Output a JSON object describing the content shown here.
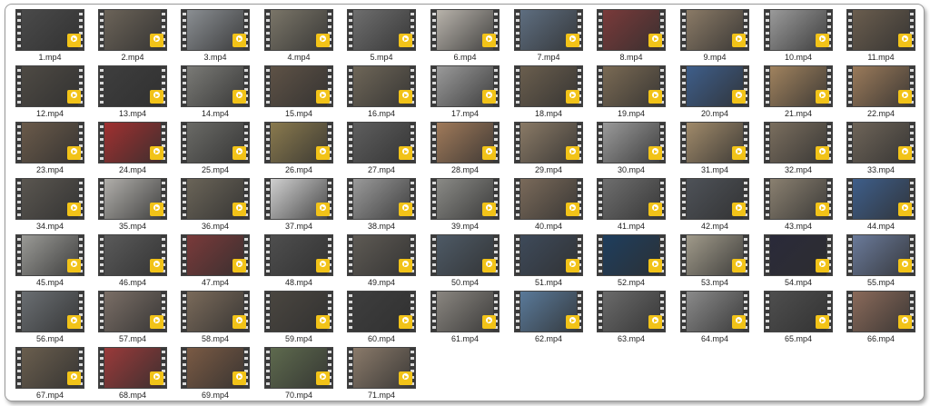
{
  "files": [
    {
      "name": "1.mp4",
      "tone": "#4a4a4a"
    },
    {
      "name": "2.mp4",
      "tone": "#6b6358"
    },
    {
      "name": "3.mp4",
      "tone": "#8a8e92"
    },
    {
      "name": "4.mp4",
      "tone": "#7a7568"
    },
    {
      "name": "5.mp4",
      "tone": "#6e6e6e"
    },
    {
      "name": "6.mp4",
      "tone": "#b8b3ab"
    },
    {
      "name": "7.mp4",
      "tone": "#5e6e80"
    },
    {
      "name": "8.mp4",
      "tone": "#7a3a3a"
    },
    {
      "name": "9.mp4",
      "tone": "#8a7a66"
    },
    {
      "name": "10.mp4",
      "tone": "#9a9a9a"
    },
    {
      "name": "11.mp4",
      "tone": "#6a5d4e"
    },
    {
      "name": "12.mp4",
      "tone": "#4e4a44"
    },
    {
      "name": "13.mp4",
      "tone": "#3e3e3e"
    },
    {
      "name": "14.mp4",
      "tone": "#7a7a76"
    },
    {
      "name": "15.mp4",
      "tone": "#5e5246"
    },
    {
      "name": "16.mp4",
      "tone": "#6e6658"
    },
    {
      "name": "17.mp4",
      "tone": "#9a9a9a"
    },
    {
      "name": "18.mp4",
      "tone": "#6a5e4e"
    },
    {
      "name": "19.mp4",
      "tone": "#7a6a54"
    },
    {
      "name": "20.mp4",
      "tone": "#3e5e8a"
    },
    {
      "name": "21.mp4",
      "tone": "#a0825e"
    },
    {
      "name": "22.mp4",
      "tone": "#9a7a5a"
    },
    {
      "name": "23.mp4",
      "tone": "#6a5a4a"
    },
    {
      "name": "24.mp4",
      "tone": "#a03030"
    },
    {
      "name": "25.mp4",
      "tone": "#6a6a66"
    },
    {
      "name": "26.mp4",
      "tone": "#8a7a4e"
    },
    {
      "name": "27.mp4",
      "tone": "#5e5e5e"
    },
    {
      "name": "28.mp4",
      "tone": "#a07a5a"
    },
    {
      "name": "29.mp4",
      "tone": "#8a7a66"
    },
    {
      "name": "30.mp4",
      "tone": "#9a9a9a"
    },
    {
      "name": "31.mp4",
      "tone": "#a08a6a"
    },
    {
      "name": "32.mp4",
      "tone": "#7a6e5e"
    },
    {
      "name": "33.mp4",
      "tone": "#6e6458"
    },
    {
      "name": "34.mp4",
      "tone": "#5a5650"
    },
    {
      "name": "35.mp4",
      "tone": "#b0aeaa"
    },
    {
      "name": "36.mp4",
      "tone": "#6a6458"
    },
    {
      "name": "37.mp4",
      "tone": "#d0d0d0"
    },
    {
      "name": "38.mp4",
      "tone": "#9a9a9a"
    },
    {
      "name": "39.mp4",
      "tone": "#8a8a86"
    },
    {
      "name": "40.mp4",
      "tone": "#7a6a5a"
    },
    {
      "name": "41.mp4",
      "tone": "#6e6e6e"
    },
    {
      "name": "42.mp4",
      "tone": "#4e5258"
    },
    {
      "name": "43.mp4",
      "tone": "#8a8070"
    },
    {
      "name": "44.mp4",
      "tone": "#3e5e8a"
    },
    {
      "name": "45.mp4",
      "tone": "#9a9a96"
    },
    {
      "name": "46.mp4",
      "tone": "#5a5a5a"
    },
    {
      "name": "47.mp4",
      "tone": "#7a3a3a"
    },
    {
      "name": "48.mp4",
      "tone": "#4e4e4e"
    },
    {
      "name": "49.mp4",
      "tone": "#5e5a54"
    },
    {
      "name": "50.mp4",
      "tone": "#4e5a66"
    },
    {
      "name": "51.mp4",
      "tone": "#3e4a5a"
    },
    {
      "name": "52.mp4",
      "tone": "#1e3e5e"
    },
    {
      "name": "53.mp4",
      "tone": "#a09a8a"
    },
    {
      "name": "54.mp4",
      "tone": "#2a2a3a"
    },
    {
      "name": "55.mp4",
      "tone": "#6a7a9a"
    },
    {
      "name": "56.mp4",
      "tone": "#6a6e72"
    },
    {
      "name": "57.mp4",
      "tone": "#7a6e66"
    },
    {
      "name": "58.mp4",
      "tone": "#7a6a5a"
    },
    {
      "name": "59.mp4",
      "tone": "#4a4640"
    },
    {
      "name": "60.mp4",
      "tone": "#3e3e3e"
    },
    {
      "name": "61.mp4",
      "tone": "#8a8680"
    },
    {
      "name": "62.mp4",
      "tone": "#5a7a9a"
    },
    {
      "name": "63.mp4",
      "tone": "#6a6a6a"
    },
    {
      "name": "64.mp4",
      "tone": "#8a8a8a"
    },
    {
      "name": "65.mp4",
      "tone": "#4e4e4e"
    },
    {
      "name": "66.mp4",
      "tone": "#8a6a5a"
    },
    {
      "name": "67.mp4",
      "tone": "#6a5e4e"
    },
    {
      "name": "68.mp4",
      "tone": "#9a3a3a"
    },
    {
      "name": "69.mp4",
      "tone": "#7a5a44"
    },
    {
      "name": "70.mp4",
      "tone": "#5e6a4e"
    },
    {
      "name": "71.mp4",
      "tone": "#8a7a6a"
    }
  ],
  "badge_icon": "player-badge-icon",
  "accent": "#f2c318"
}
